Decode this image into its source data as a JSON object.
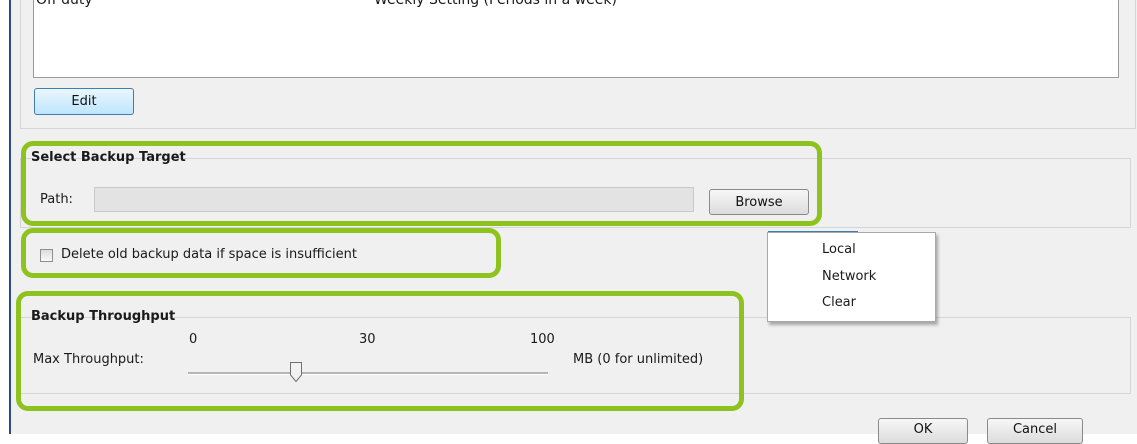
{
  "schedule": {
    "rows": [
      {
        "name": "Off duty",
        "setting": "Weekly Setting (Periods in a week)"
      }
    ],
    "edit_label": "Edit"
  },
  "backup_target": {
    "title": "Select Backup Target",
    "path_label": "Path:",
    "path_value": "",
    "browse_label": "Browse"
  },
  "delete_old": {
    "label": "Delete old backup data if space is insufficient",
    "checked": false
  },
  "browse_menu": {
    "items": [
      "Local",
      "Network",
      "Clear"
    ]
  },
  "throughput": {
    "title": "Backup Throughput",
    "label": "Max Throughput:",
    "ticks": [
      "0",
      "30",
      "100"
    ],
    "value": 30,
    "unit": "MB (0 for unlimited)"
  },
  "footer": {
    "ok_label": "OK",
    "cancel_label": "Cancel"
  },
  "colors": {
    "highlight": "#8ec31f",
    "focus_blue": "#3c7fb1"
  }
}
